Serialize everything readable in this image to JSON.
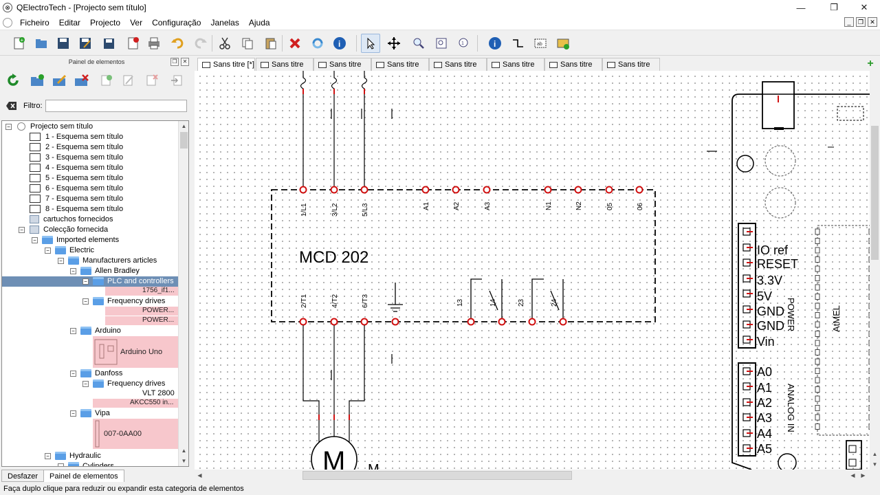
{
  "window": {
    "title": "QElectroTech - [Projecto sem título]",
    "minimize_glyph": "—",
    "restore_glyph": "❐",
    "close_glyph": "✕"
  },
  "menu": {
    "items": [
      "Ficheiro",
      "Editar",
      "Projecto",
      "Ver",
      "Configuração",
      "Janelas",
      "Ajuda"
    ]
  },
  "toolbar": {
    "buttons": [
      {
        "name": "new-icon"
      },
      {
        "name": "open-icon"
      },
      {
        "name": "save-icon"
      },
      {
        "name": "save-as-icon"
      },
      {
        "name": "save-all-icon"
      },
      {
        "name": "close-project-icon"
      },
      {
        "name": "print-icon"
      },
      {
        "name": "undo-icon"
      },
      {
        "name": "redo-icon"
      },
      {
        "name": "cut-icon"
      },
      {
        "name": "copy-icon"
      },
      {
        "name": "paste-icon"
      },
      {
        "name": "delete-icon"
      },
      {
        "name": "rotate-icon"
      },
      {
        "name": "info-icon"
      },
      {
        "name": "select-icon"
      },
      {
        "name": "move-icon"
      },
      {
        "name": "zoom-in-icon"
      },
      {
        "name": "zoom-fit-icon"
      },
      {
        "name": "zoom-reset-icon"
      },
      {
        "name": "properties-icon"
      },
      {
        "name": "conductor-icon"
      },
      {
        "name": "text-field-icon"
      },
      {
        "name": "add-image-icon"
      }
    ]
  },
  "left_panel": {
    "title": "Painel de elementos",
    "filter_label": "Filtro:",
    "filter_value": "",
    "tree": {
      "project": "Projecto sem título",
      "sheets": [
        "1 - Esquema sem título",
        "2 - Esquema sem título",
        "3 - Esquema sem título",
        "4 - Esquema sem título",
        "5 - Esquema sem título",
        "6 - Esquema sem título",
        "7 - Esquema sem título",
        "8 - Esquema sem título"
      ],
      "cartuchos": "cartuchos fornecidos",
      "colecao": "Colecção fornecida",
      "imported": "Imported elements",
      "electric": "Electric",
      "manufacturers": "Manufacturers articles",
      "allen_bradley": "Allen Bradley",
      "plc": "PLC and controllers",
      "plc_item": "1756_if1...",
      "freq_drives": "Frequency drives",
      "power1": "POWER...",
      "power2": "POWER...",
      "arduino": "Arduino",
      "arduino_uno": "Arduino Uno",
      "danfoss": "Danfoss",
      "danfoss_freq": "Frequency drives",
      "vlt": "VLT 2800",
      "akcc": "AKCC550 in...",
      "vipa": "Vipa",
      "vipa_item": "007-0AA00",
      "hydraulic": "Hydraulic",
      "cylinders": "Cylinders"
    },
    "bottom_tabs": [
      "Desfazer",
      "Painel de elementos"
    ]
  },
  "doc_tabs": [
    "Sans titre [*]",
    "Sans titre",
    "Sans titre",
    "Sans titre",
    "Sans titre",
    "Sans titre",
    "Sans titre",
    "Sans titre"
  ],
  "schematic": {
    "device_name": "MCD 202",
    "top_terminals": [
      "1/L1",
      "3/L2",
      "5/L3",
      "A1",
      "A2",
      "A3",
      "N1",
      "N2",
      "05",
      "06"
    ],
    "bottom_terminals": [
      "2/T1",
      "4/T2",
      "6/T3",
      "13",
      "14",
      "23",
      "24"
    ],
    "motor_label": "M",
    "motor_tag": "M",
    "arduino_power_pins": [
      "IO ref",
      "RESET",
      "3.3V",
      "5V",
      "GND",
      "GND",
      "Vin"
    ],
    "arduino_analog_pins": [
      "A0",
      "A1",
      "A2",
      "A3",
      "A4",
      "A5"
    ],
    "power_label": "POWER",
    "analog_label": "ANALOG IN",
    "atmel_label": "AtMEL"
  },
  "status": {
    "text": "Faça duplo clique para reduzir ou expandir esta categoria de elementos"
  },
  "colors": {
    "selection": "#6e8fb5",
    "thumb_bg": "#f7c7cc",
    "terminal_red": "#d01010",
    "folder_blue": "#5a9ee6"
  }
}
